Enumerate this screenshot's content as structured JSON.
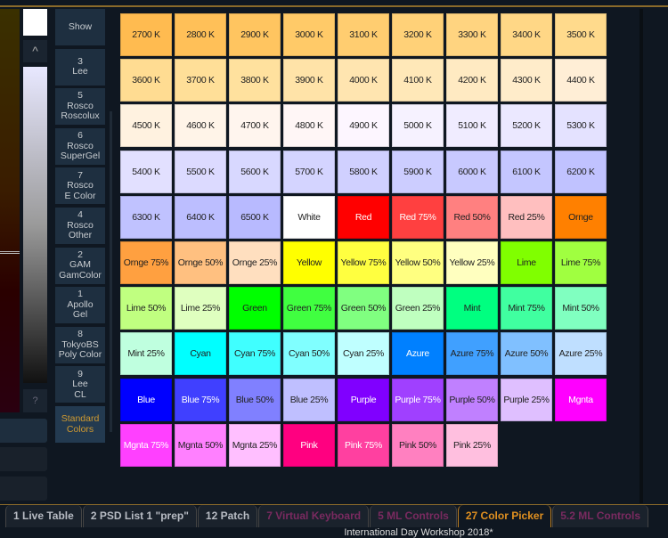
{
  "left": {
    "question_label": "?",
    "up_label": "^"
  },
  "gels": [
    {
      "label": "Show"
    },
    {
      "label": "3\nLee"
    },
    {
      "label": "5\nRosco\nRoscolux"
    },
    {
      "label": "6\nRosco\nSuperGel"
    },
    {
      "label": "7\nRosco\nE Color"
    },
    {
      "label": "4\nRosco\nOther"
    },
    {
      "label": "2\nGAM\nGamColor"
    },
    {
      "label": "1\nApollo\nGel"
    },
    {
      "label": "8\nTokyoBS\nPoly Color"
    },
    {
      "label": "9\nLee\nCL"
    },
    {
      "label": "Standard\nColors",
      "active": true
    }
  ],
  "colors": [
    {
      "label": "2700 K",
      "color": "#ffbb50"
    },
    {
      "label": "2800 K",
      "color": "#ffc058"
    },
    {
      "label": "2900 K",
      "color": "#ffc560"
    },
    {
      "label": "3000 K",
      "color": "#ffca68"
    },
    {
      "label": "3100 K",
      "color": "#ffcd70"
    },
    {
      "label": "3200 K",
      "color": "#ffd178"
    },
    {
      "label": "3300 K",
      "color": "#ffd480"
    },
    {
      "label": "3400 K",
      "color": "#ffd786"
    },
    {
      "label": "3500 K",
      "color": "#ffda8c"
    },
    {
      "label": "3600 K",
      "color": "#ffdc92"
    },
    {
      "label": "3700 K",
      "color": "#ffdf98"
    },
    {
      "label": "3800 K",
      "color": "#ffe19e"
    },
    {
      "label": "3900 K",
      "color": "#ffe3a8"
    },
    {
      "label": "4000 K",
      "color": "#ffe5b0"
    },
    {
      "label": "4100 K",
      "color": "#ffe8b8"
    },
    {
      "label": "4200 K",
      "color": "#ffeac2"
    },
    {
      "label": "4300 K",
      "color": "#ffecca"
    },
    {
      "label": "4400 K",
      "color": "#ffeed6"
    },
    {
      "label": "4500 K",
      "color": "#fff2e0"
    },
    {
      "label": "4600 K",
      "color": "#fff4e8"
    },
    {
      "label": "4700 K",
      "color": "#fff5ee"
    },
    {
      "label": "4800 K",
      "color": "#fff6f6"
    },
    {
      "label": "4900 K",
      "color": "#fdf6ff"
    },
    {
      "label": "5000 K",
      "color": "#f6f2ff"
    },
    {
      "label": "5100 K",
      "color": "#f0ecff"
    },
    {
      "label": "5200 K",
      "color": "#ebe8ff"
    },
    {
      "label": "5300 K",
      "color": "#e4e2ff"
    },
    {
      "label": "5400 K",
      "color": "#e2e0ff"
    },
    {
      "label": "5500 K",
      "color": "#dcdaff"
    },
    {
      "label": "5600 K",
      "color": "#d8d8ff"
    },
    {
      "label": "5700 K",
      "color": "#d4d4ff"
    },
    {
      "label": "5800 K",
      "color": "#d0d0ff"
    },
    {
      "label": "5900 K",
      "color": "#cccdff"
    },
    {
      "label": "6000 K",
      "color": "#c8c9ff"
    },
    {
      "label": "6100 K",
      "color": "#c4c6ff"
    },
    {
      "label": "6200 K",
      "color": "#c0c2ff"
    },
    {
      "label": "6300 K",
      "color": "#c0c2ff"
    },
    {
      "label": "6400 K",
      "color": "#bcbeff"
    },
    {
      "label": "6500 K",
      "color": "#b8baff"
    },
    {
      "label": "White",
      "color": "#ffffff"
    },
    {
      "label": "Red",
      "color": "#ff0000",
      "light": true
    },
    {
      "label": "Red 75%",
      "color": "#ff4040",
      "light": true
    },
    {
      "label": "Red 50%",
      "color": "#ff8080"
    },
    {
      "label": "Red 25%",
      "color": "#ffbfbf"
    },
    {
      "label": "Ornge",
      "color": "#ff8000"
    },
    {
      "label": "Ornge 75%",
      "color": "#ffa040"
    },
    {
      "label": "Ornge 50%",
      "color": "#ffc080"
    },
    {
      "label": "Ornge 25%",
      "color": "#ffdfbf"
    },
    {
      "label": "Yellow",
      "color": "#ffff00"
    },
    {
      "label": "Yellow 75%",
      "color": "#ffff40"
    },
    {
      "label": "Yellow 50%",
      "color": "#ffff80"
    },
    {
      "label": "Yellow 25%",
      "color": "#ffffbf"
    },
    {
      "label": "Lime",
      "color": "#80ff00"
    },
    {
      "label": "Lime 75%",
      "color": "#a0ff40"
    },
    {
      "label": "Lime 50%",
      "color": "#c0ff80"
    },
    {
      "label": "Lime 25%",
      "color": "#dfffbf"
    },
    {
      "label": "Green",
      "color": "#00ff00"
    },
    {
      "label": "Green 75%",
      "color": "#40ff40"
    },
    {
      "label": "Green 50%",
      "color": "#80ff80"
    },
    {
      "label": "Green 25%",
      "color": "#bfffbf"
    },
    {
      "label": "Mint",
      "color": "#00ff80"
    },
    {
      "label": "Mint 75%",
      "color": "#40ffa0"
    },
    {
      "label": "Mint 50%",
      "color": "#80ffc0"
    },
    {
      "label": "Mint 25%",
      "color": "#bfffdf"
    },
    {
      "label": "Cyan",
      "color": "#00ffff"
    },
    {
      "label": "Cyan 75%",
      "color": "#40ffff"
    },
    {
      "label": "Cyan 50%",
      "color": "#80ffff"
    },
    {
      "label": "Cyan 25%",
      "color": "#bfffff"
    },
    {
      "label": "Azure",
      "color": "#0080ff",
      "light": true
    },
    {
      "label": "Azure 75%",
      "color": "#40a0ff"
    },
    {
      "label": "Azure 50%",
      "color": "#80c0ff"
    },
    {
      "label": "Azure 25%",
      "color": "#bfdfff"
    },
    {
      "label": "Blue",
      "color": "#0000ff",
      "light": true
    },
    {
      "label": "Blue 75%",
      "color": "#4040ff",
      "light": true
    },
    {
      "label": "Blue 50%",
      "color": "#8080ff"
    },
    {
      "label": "Blue 25%",
      "color": "#bfbfff"
    },
    {
      "label": "Purple",
      "color": "#8000ff",
      "light": true
    },
    {
      "label": "Purple 75%",
      "color": "#a040ff",
      "light": true
    },
    {
      "label": "Purple 50%",
      "color": "#c080ff"
    },
    {
      "label": "Purple 25%",
      "color": "#dfbfff"
    },
    {
      "label": "Mgnta",
      "color": "#ff00ff",
      "light": true
    },
    {
      "label": "Mgnta 75%",
      "color": "#ff40ff",
      "light": true
    },
    {
      "label": "Mgnta 50%",
      "color": "#ff80ff"
    },
    {
      "label": "Mgnta 25%",
      "color": "#ffbfff"
    },
    {
      "label": "Pink",
      "color": "#ff0080",
      "light": true
    },
    {
      "label": "Pink 75%",
      "color": "#ff40a0",
      "light": true
    },
    {
      "label": "Pink 50%",
      "color": "#ff80c0"
    },
    {
      "label": "Pink 25%",
      "color": "#ffbfdf"
    }
  ],
  "tabs": [
    {
      "label": "1 Live Table"
    },
    {
      "label": "2 PSD List 1 \"prep\""
    },
    {
      "label": "12 Patch"
    },
    {
      "label": "7 Virtual Keyboard",
      "dim": true
    },
    {
      "label": "5 ML Controls",
      "dim": true
    },
    {
      "label": "27 Color Picker",
      "active": true
    },
    {
      "label": "5.2 ML Controls",
      "dim": true
    }
  ],
  "footer": "International Day Workshop 2018*"
}
